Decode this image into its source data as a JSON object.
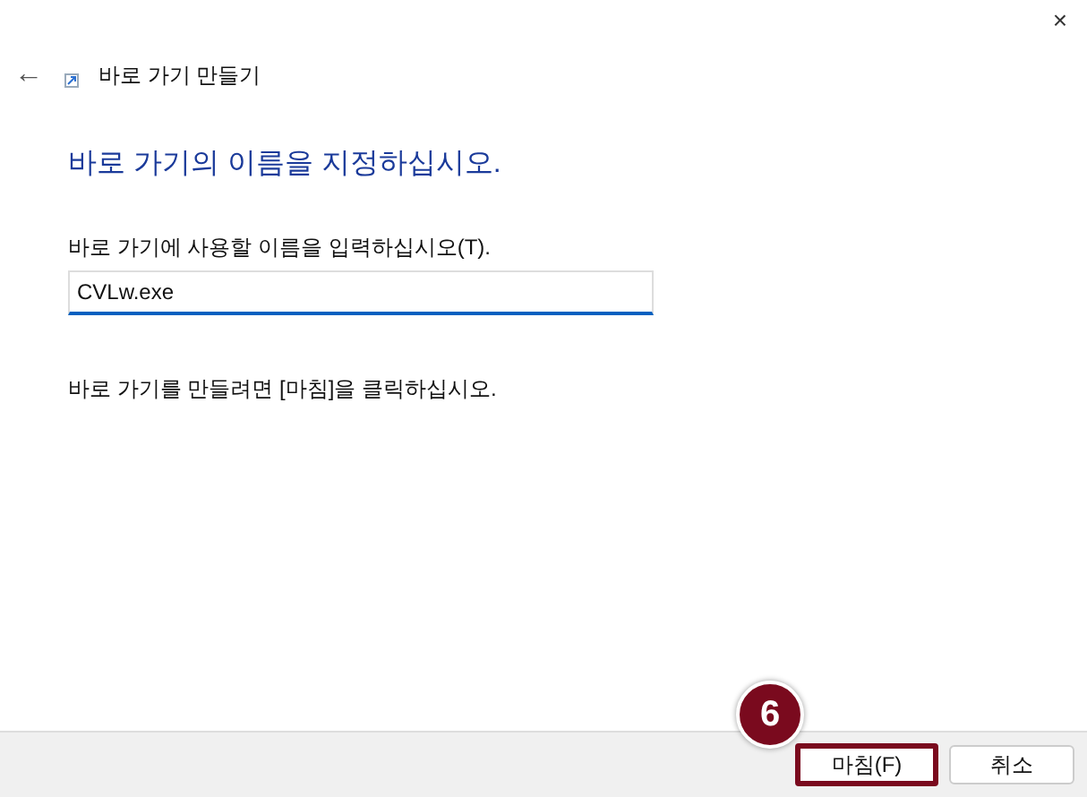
{
  "window": {
    "close": "×"
  },
  "header": {
    "back": "←",
    "title": "바로 가기 만들기"
  },
  "heading": "바로 가기의 이름을 지정하십시오.",
  "name_field": {
    "label": "바로 가기에 사용할 이름을 입력하십시오(T).",
    "value": "CVLw.exe"
  },
  "instruction": "바로 가기를 만들려면 [마침]을 클릭하십시오.",
  "buttons": [
    {
      "label": "마침(F)",
      "highlighted": true
    },
    {
      "label": "취소",
      "highlighted": false
    }
  ],
  "step_badge": "6"
}
